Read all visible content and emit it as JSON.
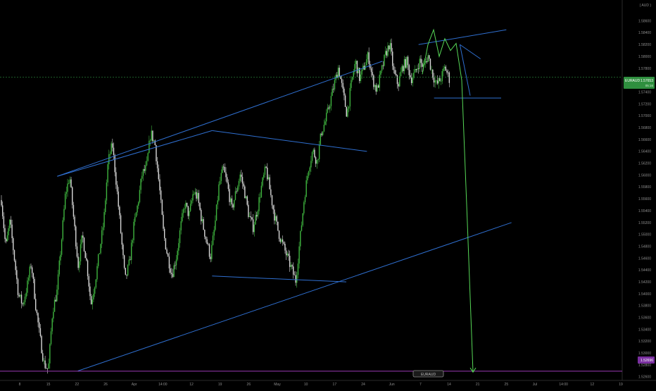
{
  "currency_label": "( AUD )",
  "symbol": "EURAUD",
  "price_tag": "1.57653",
  "countdown": "05:16",
  "target_tag": "1.52696",
  "watermark": "EURAUD",
  "colors": {
    "background": "#000000",
    "candle_up": "#3fb53f",
    "candle_down": "#d9d9d9",
    "trend_lines": "#2f6fd0",
    "projection": "#57d957",
    "target_line": "#9b3bb5",
    "price_tag_bg": "#2f8f3f",
    "target_tag_bg": "#7a2fa0",
    "axis_text": "#8c8c8c"
  },
  "chart_data": {
    "type": "candlestick",
    "ylim": [
      1.5254,
      1.5888
    ],
    "y_ticks": [
      "1.58600",
      "1.58400",
      "1.58200",
      "1.58000",
      "1.57800",
      "1.57600",
      "1.57400",
      "1.57200",
      "1.57000",
      "1.56800",
      "1.56600",
      "1.56400",
      "1.56200",
      "1.56000",
      "1.55800",
      "1.55600",
      "1.55400",
      "1.55200",
      "1.55000",
      "1.54800",
      "1.54600",
      "1.54400",
      "1.54200",
      "1.54000",
      "1.53800",
      "1.53600",
      "1.53400",
      "1.53200",
      "1.53000",
      "1.52800",
      "1.52600"
    ],
    "x_ticks": [
      "8",
      "15",
      "22",
      "26",
      "Apr",
      "14:00",
      "12",
      "19",
      "26",
      "May",
      "10",
      "17",
      "24",
      "Jun",
      "7",
      "14",
      "21",
      "25",
      "Jul",
      "14:00",
      "12",
      "19"
    ],
    "anchor_points": [
      [
        1.5558,
        1.5478,
        1.5522,
        1.5462,
        1.5398,
        1.5382,
        1.5412,
        1.5452,
        1.5382,
        1.5328,
        1.5282,
        1.5272
      ],
      [
        1.5372,
        1.5402,
        1.5482,
        1.5568,
        1.5598,
        1.5522,
        1.5448,
        1.5498,
        1.5452,
        1.5382,
        1.5422,
        1.5472
      ],
      [
        1.5522,
        1.5622,
        1.5652,
        1.5582,
        1.5502,
        1.5422,
        1.5452,
        1.5512,
        1.5552,
        1.5602,
        1.5612,
        1.5672
      ],
      [
        1.5652,
        1.5582,
        1.5502,
        1.5462,
        1.5432,
        1.5462,
        1.5512,
        1.5552,
        1.5532,
        1.5572,
        1.5562,
        1.5522
      ],
      [
        1.5492,
        1.5462,
        1.5512,
        1.5582,
        1.5612,
        1.5582,
        1.5542,
        1.5572,
        1.5602,
        1.5572,
        1.5532,
        1.5512
      ],
      [
        1.5542,
        1.5582,
        1.5612,
        1.5572,
        1.5532,
        1.5502,
        1.5482,
        1.5462,
        1.5442,
        1.5422,
        1.5492,
        1.5562
      ],
      [
        1.5612,
        1.5642,
        1.5622,
        1.5672,
        1.5692,
        1.5722,
        1.5752,
        1.5782,
        1.5742,
        1.5702,
        1.5752,
        1.5792
      ],
      [
        1.5762,
        1.5782,
        1.5802,
        1.5762,
        1.5742,
        1.5772,
        1.5802,
        1.5822,
        1.5772,
        1.5752,
        1.5782,
        1.5792
      ],
      [
        1.5762,
        1.5772,
        1.5792,
        1.5782,
        1.5802,
        1.5772,
        1.5752,
        1.5762,
        1.5782,
        1.5762
      ]
    ],
    "markup_lines": [
      [
        [
          1.5598,
          "2021-03-15"
        ],
        [
          1.5675,
          "2021-04-14"
        ]
      ],
      [
        [
          1.5675,
          "2021-04-14"
        ],
        [
          1.564,
          "2021-05-14"
        ]
      ],
      [
        [
          1.543,
          "2021-04-14"
        ],
        [
          1.542,
          "2021-05-10"
        ]
      ],
      [
        [
          1.527,
          "2021-03-19"
        ],
        [
          1.552,
          "2021-06-11"
        ]
      ],
      [
        [
          1.5598,
          "2021-03-15"
        ],
        [
          1.5792,
          "2021-05-17"
        ]
      ],
      [
        [
          1.582,
          "2021-05-24"
        ],
        [
          1.5845,
          "2021-06-10"
        ]
      ],
      [
        [
          1.573,
          "2021-05-27"
        ],
        [
          1.573,
          "2021-06-09"
        ]
      ],
      [
        [
          1.582,
          "2021-06-01"
        ],
        [
          1.5796,
          "2021-06-05"
        ]
      ],
      [
        [
          1.582,
          "2021-06-01"
        ],
        [
          1.5734,
          "2021-06-03"
        ]
      ]
    ],
    "projection": [
      1.577,
      1.582,
      1.5845,
      1.58,
      1.583,
      1.581,
      1.5822,
      1.576,
      1.552,
      1.5268
    ],
    "current_price": 1.57653,
    "target_price": 1.52696
  }
}
